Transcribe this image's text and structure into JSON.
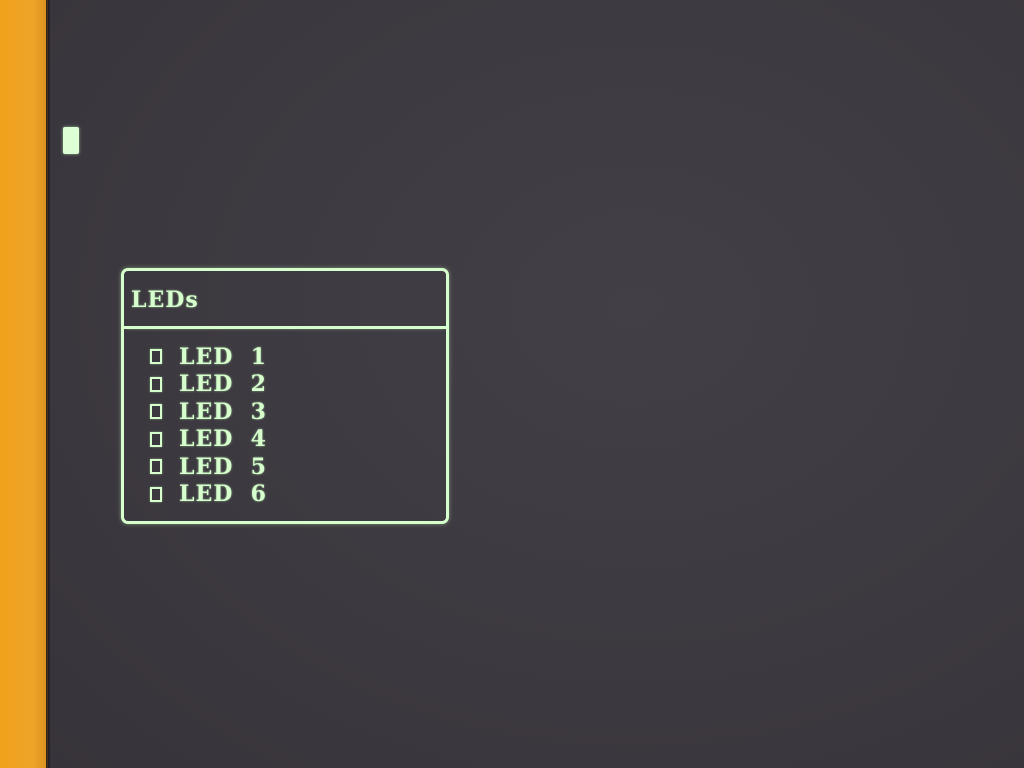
{
  "window": {
    "title": "LEDs"
  },
  "leds": [
    {
      "label": "LED  1",
      "checked": false
    },
    {
      "label": "LED  2",
      "checked": false
    },
    {
      "label": "LED  3",
      "checked": false
    },
    {
      "label": "LED  4",
      "checked": false
    },
    {
      "label": "LED  5",
      "checked": false
    },
    {
      "label": "LED  6",
      "checked": false
    }
  ],
  "colors": {
    "foreground": "#d6ffcd",
    "background": "#3e3a42",
    "bezel": "#f0a21c"
  }
}
